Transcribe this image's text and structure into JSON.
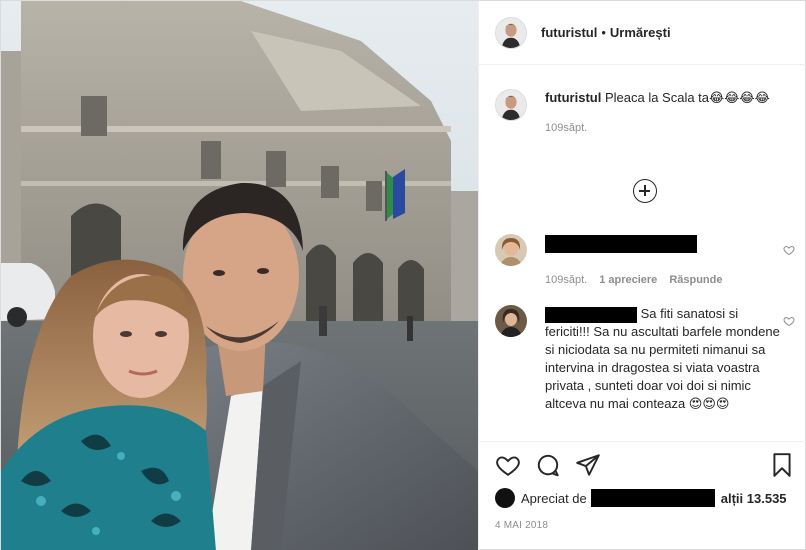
{
  "header": {
    "username": "futuristul",
    "separator": "•",
    "follow_status": "Urmărești"
  },
  "caption": {
    "username": "futuristul",
    "text": "Pleaca la Scala ta😂😂😂😂",
    "time": "109săpt."
  },
  "comments": [
    {
      "time": "109săpt.",
      "likes": "1 apreciere",
      "reply": "Răspunde"
    },
    {
      "text": "Sa fiti sanatosi si fericiti!!! Sa nu ascultati barfele mondene si niciodata sa nu permiteti nimanui sa intervina in dragostea si viata voastra privata , sunteti doar voi doi si nimic altceva nu mai conteaza 😍😍😍"
    }
  ],
  "actions": {
    "like_icon": "heart-icon",
    "comment_icon": "comment-icon",
    "share_icon": "share-icon",
    "save_icon": "bookmark-icon"
  },
  "likes": {
    "prefix": "Apreciat de",
    "others": "alții 13.535"
  },
  "date": "4 MAI 2018"
}
